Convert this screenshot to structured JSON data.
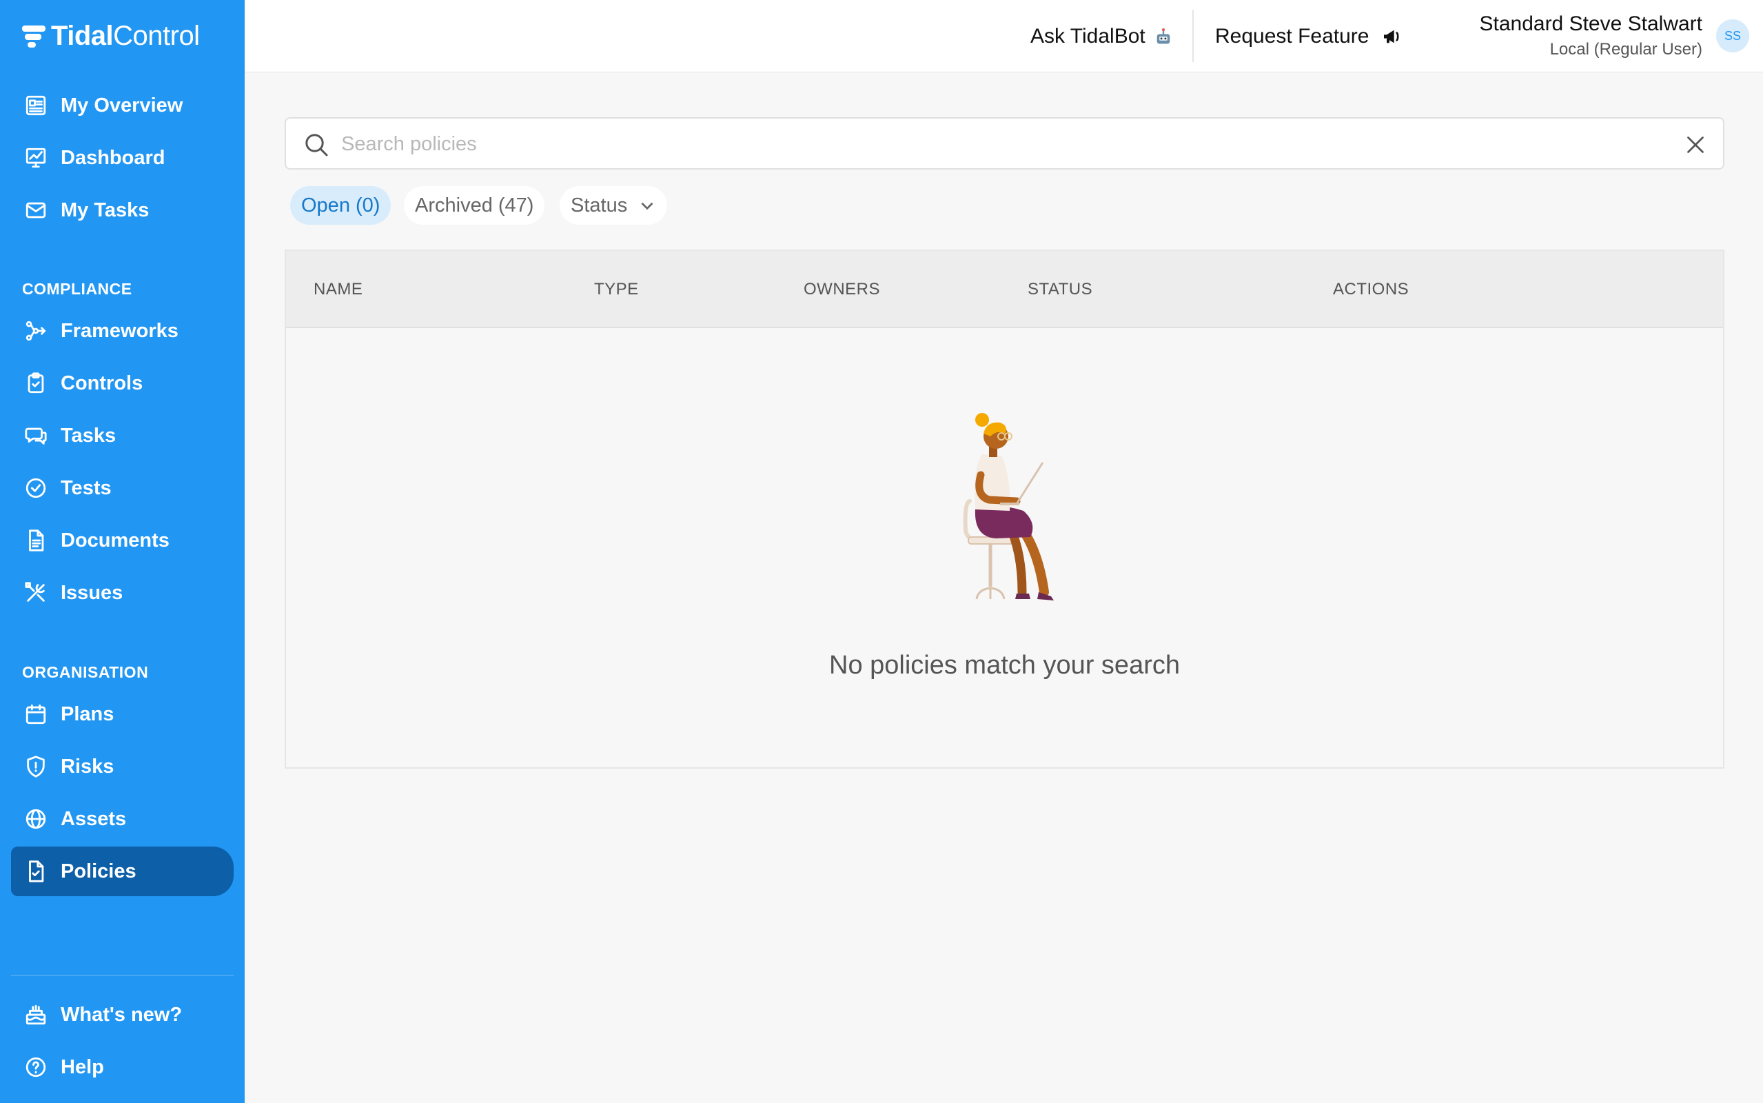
{
  "brand": {
    "name_bold": "Tidal",
    "name_light": "Control"
  },
  "sidebar": {
    "top_items": [
      {
        "label": "My Overview",
        "icon": "overview-icon"
      },
      {
        "label": "Dashboard",
        "icon": "dashboard-icon"
      },
      {
        "label": "My Tasks",
        "icon": "mail-icon"
      }
    ],
    "compliance_title": "COMPLIANCE",
    "compliance_items": [
      {
        "label": "Frameworks",
        "icon": "frameworks-icon"
      },
      {
        "label": "Controls",
        "icon": "controls-icon"
      },
      {
        "label": "Tasks",
        "icon": "chat-icon"
      },
      {
        "label": "Tests",
        "icon": "check-circle-icon"
      },
      {
        "label": "Documents",
        "icon": "document-icon"
      },
      {
        "label": "Issues",
        "icon": "tools-icon"
      }
    ],
    "organisation_title": "ORGANISATION",
    "organisation_items": [
      {
        "label": "Plans",
        "icon": "calendar-icon"
      },
      {
        "label": "Risks",
        "icon": "shield-icon"
      },
      {
        "label": "Assets",
        "icon": "globe-icon"
      },
      {
        "label": "Policies",
        "icon": "policy-icon",
        "active": true
      }
    ],
    "bottom_items": [
      {
        "label": "What's new?",
        "icon": "cake-icon"
      },
      {
        "label": "Help",
        "icon": "help-icon"
      }
    ]
  },
  "topbar": {
    "ask_bot": "Ask TidalBot",
    "request_feature": "Request Feature",
    "user_name": "Standard Steve Stalwart",
    "user_role": "Local (Regular User)",
    "avatar_initials": "SS"
  },
  "search": {
    "placeholder": "Search policies",
    "value": ""
  },
  "filters": {
    "open": "Open (0)",
    "archived": "Archived (47)",
    "status": "Status"
  },
  "table": {
    "columns": [
      "NAME",
      "TYPE",
      "OWNERS",
      "STATUS",
      "ACTIONS"
    ],
    "rows": [],
    "empty_message": "No policies match your search"
  },
  "colors": {
    "accent": "#2196f3",
    "active_nav": "#0d5fa8",
    "chip_active_bg": "#d8ecfc"
  }
}
